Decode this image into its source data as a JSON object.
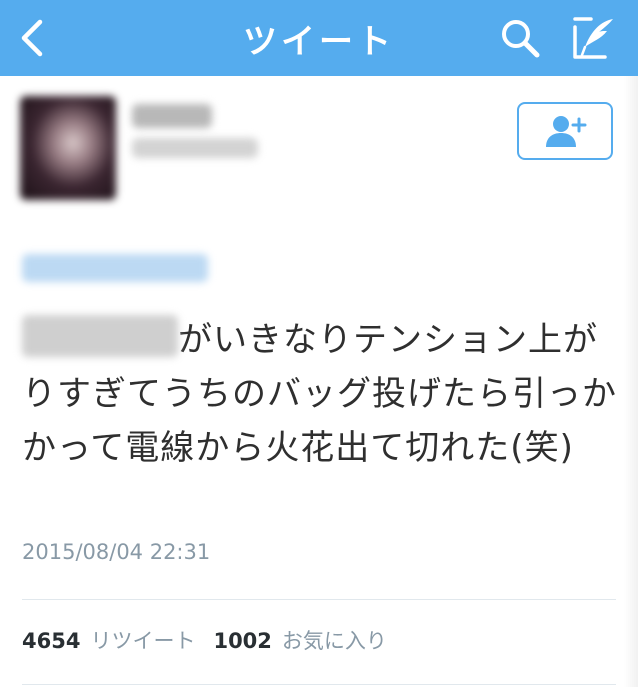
{
  "colors": {
    "accent": "#55acee",
    "text": "#2f2f2f",
    "meta": "#8899a6",
    "divider": "#e1e8ed"
  },
  "header": {
    "title": "ツイート",
    "icons": [
      "back-icon",
      "search-icon",
      "compose-icon"
    ]
  },
  "follow_button": {
    "icon": "add-user-icon"
  },
  "tweet": {
    "text": "がいきなりテンション上がりすぎてうちのバッグ投げたら引っかかって電線から火花出て切れた(笑)",
    "timestamp": "2015/08/04 22:31"
  },
  "stats": {
    "retweets_count": "4654",
    "retweets_label": "リツイート",
    "favorites_count": "1002",
    "favorites_label": "お気に入り"
  }
}
